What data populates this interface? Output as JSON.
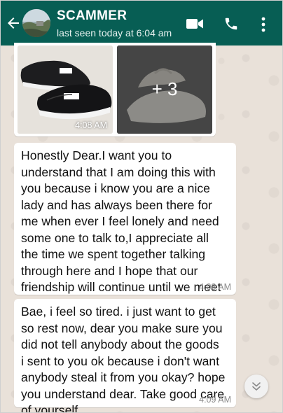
{
  "header": {
    "contact_name": "SCAMMER",
    "status": "last seen today at 6:04 am",
    "icons": [
      "back-arrow-icon",
      "video-call-icon",
      "phone-icon",
      "more-vert-icon"
    ],
    "color": "#075e54"
  },
  "image_message": {
    "more_count": "+ 3",
    "time": "4:08 AM"
  },
  "messages": [
    {
      "text": "Honestly Dear.I want you to\nunderstand that I am doing this with\nyou because i know you are a nice\nlady and has always been there for\nme when ever I feel lonely and need\nsome one to talk to,I appreciate all\nthe time we spent together talking\nthrough here and I hope that our\nfriendship will continue until we meet\neach other face to face",
      "time": "4:08 AM"
    },
    {
      "text": "Bae, i feel so tired. i just want to get\nso rest now, dear you make sure you\ndid not tell anybody about the goods\ni sent to you ok because i don't want\nanybody steal it from you okay? hope\nyou understand dear. Take good care\nof yourself",
      "time": "4:09 AM"
    }
  ],
  "scroll_button": {
    "icon": "double-chevron-down-icon"
  },
  "colors": {
    "header": "#075e54",
    "chat_background": "#e9e1d9",
    "bubble": "#ffffff",
    "timestamp": "#8a8a8a"
  }
}
